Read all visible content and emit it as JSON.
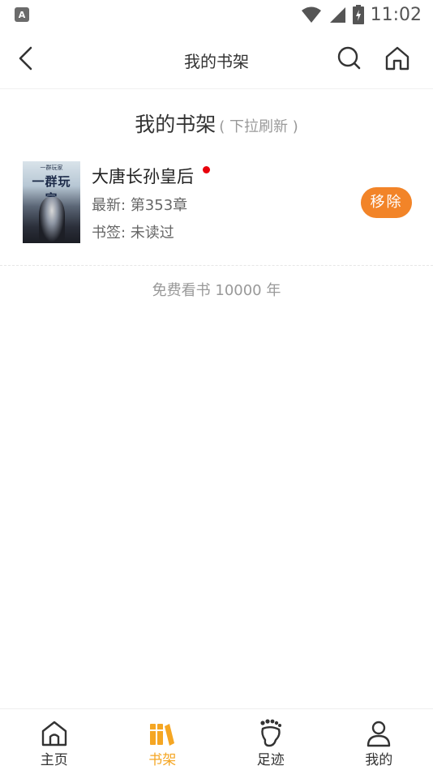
{
  "status_bar": {
    "left_badge": "A",
    "time": "11:02"
  },
  "nav": {
    "title": "我的书架"
  },
  "shelf": {
    "title": "我的书架",
    "hint": "( 下拉刷新 )"
  },
  "cover": {
    "top_text": "一群玩家",
    "title_text": "一群玩家"
  },
  "books": [
    {
      "title": "大唐长孙皇后",
      "latest": "最新: 第353章",
      "bookmark": "书签: 未读过",
      "has_update": true,
      "remove_label": "移除"
    }
  ],
  "footer_note": "免费看书 10000 年",
  "tabs": [
    {
      "label": "主页",
      "icon": "home-icon",
      "active": false
    },
    {
      "label": "书架",
      "icon": "bookshelf-icon",
      "active": true
    },
    {
      "label": "足迹",
      "icon": "footprint-icon",
      "active": false
    },
    {
      "label": "我的",
      "icon": "person-icon",
      "active": false
    }
  ],
  "colors": {
    "accent_orange": "#f28428",
    "active_tab": "#f5a623",
    "update_dot": "#e8000b"
  }
}
